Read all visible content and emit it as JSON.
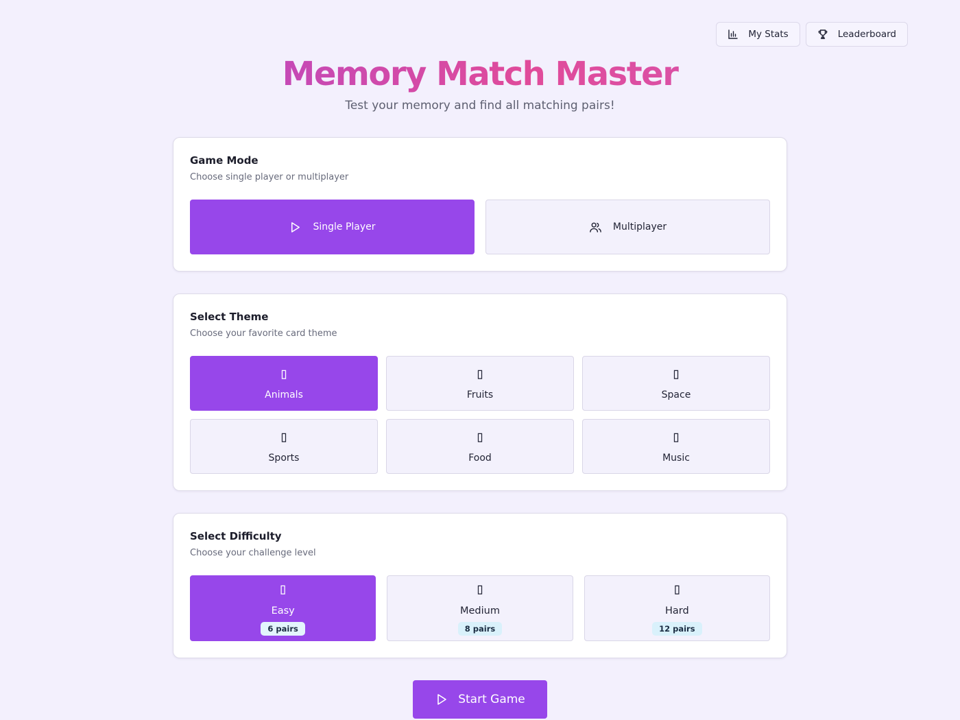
{
  "header": {
    "stats_label": "My Stats",
    "leaderboard_label": "Leaderboard",
    "title": "Memory Match Master",
    "subtitle": "Test your memory and find all matching pairs!"
  },
  "game_mode": {
    "title": "Game Mode",
    "description": "Choose single player or multiplayer",
    "options": [
      {
        "label": "Single Player",
        "icon": "play-icon",
        "selected": true
      },
      {
        "label": "Multiplayer",
        "icon": "users-icon",
        "selected": false
      }
    ]
  },
  "theme": {
    "title": "Select Theme",
    "description": "Choose your favorite card theme",
    "options": [
      {
        "label": "Animals",
        "icon": "animals-emoji-icon",
        "glyph": "▯",
        "selected": true
      },
      {
        "label": "Fruits",
        "icon": "fruits-emoji-icon",
        "glyph": "▯",
        "selected": false
      },
      {
        "label": "Space",
        "icon": "space-emoji-icon",
        "glyph": "▯",
        "selected": false
      },
      {
        "label": "Sports",
        "icon": "sports-emoji-icon",
        "glyph": "▯",
        "selected": false
      },
      {
        "label": "Food",
        "icon": "food-emoji-icon",
        "glyph": "▯",
        "selected": false
      },
      {
        "label": "Music",
        "icon": "music-emoji-icon",
        "glyph": "▯",
        "selected": false
      }
    ]
  },
  "difficulty": {
    "title": "Select Difficulty",
    "description": "Choose your challenge level",
    "options": [
      {
        "label": "Easy",
        "pairs": "6 pairs",
        "icon": "easy-emoji-icon",
        "glyph": "▯",
        "selected": true
      },
      {
        "label": "Medium",
        "pairs": "8 pairs",
        "icon": "medium-emoji-icon",
        "glyph": "▯",
        "selected": false
      },
      {
        "label": "Hard",
        "pairs": "12 pairs",
        "icon": "hard-emoji-icon",
        "glyph": "▯",
        "selected": false
      }
    ]
  },
  "start_button": {
    "label": "Start Game"
  },
  "colors": {
    "accent": "#9747ea",
    "background": "#f3f0fd",
    "title_gradient_start": "#a647d6",
    "title_gradient_end": "#e04b9a",
    "pairs_badge": "#d9f1fb"
  }
}
